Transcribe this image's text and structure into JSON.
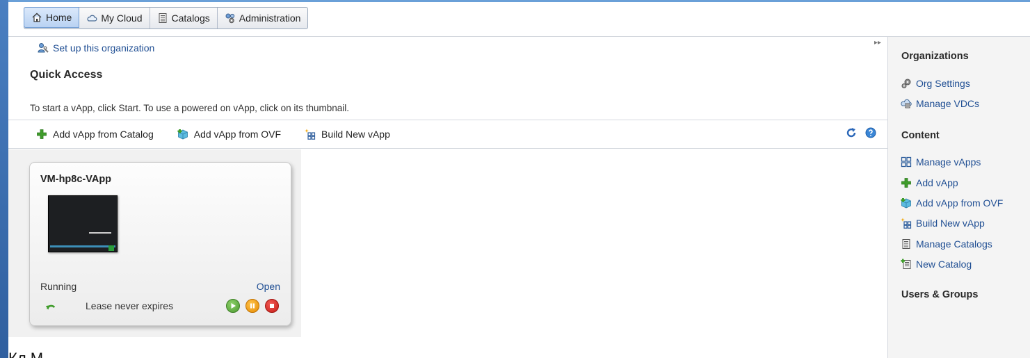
{
  "tabs": [
    {
      "label": "Home",
      "icon": "home-icon",
      "active": true
    },
    {
      "label": "My Cloud",
      "icon": "cloud-icon"
    },
    {
      "label": "Catalogs",
      "icon": "catalog-icon"
    },
    {
      "label": "Administration",
      "icon": "admin-icon"
    }
  ],
  "main": {
    "setup_link": "Set up this organization",
    "quick_access_title": "Quick Access",
    "description": "To start a vApp, click Start. To use a powered on vApp, click on its thumbnail.",
    "toolbar": {
      "add_from_catalog": "Add vApp from Catalog",
      "add_from_ovf": "Add vApp from OVF",
      "build_new": "Build New vApp"
    }
  },
  "vapp_card": {
    "name": "VM-hp8c-VApp",
    "status": "Running",
    "open_label": "Open",
    "lease": "Lease never expires"
  },
  "footer_clip": "Кл      М",
  "sidebar": {
    "organizations_heading": "Organizations",
    "org_settings": "Org Settings",
    "manage_vdcs": "Manage VDCs",
    "content_heading": "Content",
    "manage_vapps": "Manage vApps",
    "add_vapp": "Add vApp",
    "add_vapp_ovf": "Add vApp from OVF",
    "build_new_vapp": "Build New vApp",
    "manage_catalogs": "Manage Catalogs",
    "new_catalog": "New Catalog",
    "users_groups_heading": "Users & Groups"
  },
  "colors": {
    "link": "#1f4e93",
    "accent_blue": "#4a7fc1",
    "add_green": "#3f9c2b",
    "start_green": "#5cae3f",
    "pause_orange": "#f0a020",
    "stop_red": "#d92b25"
  }
}
